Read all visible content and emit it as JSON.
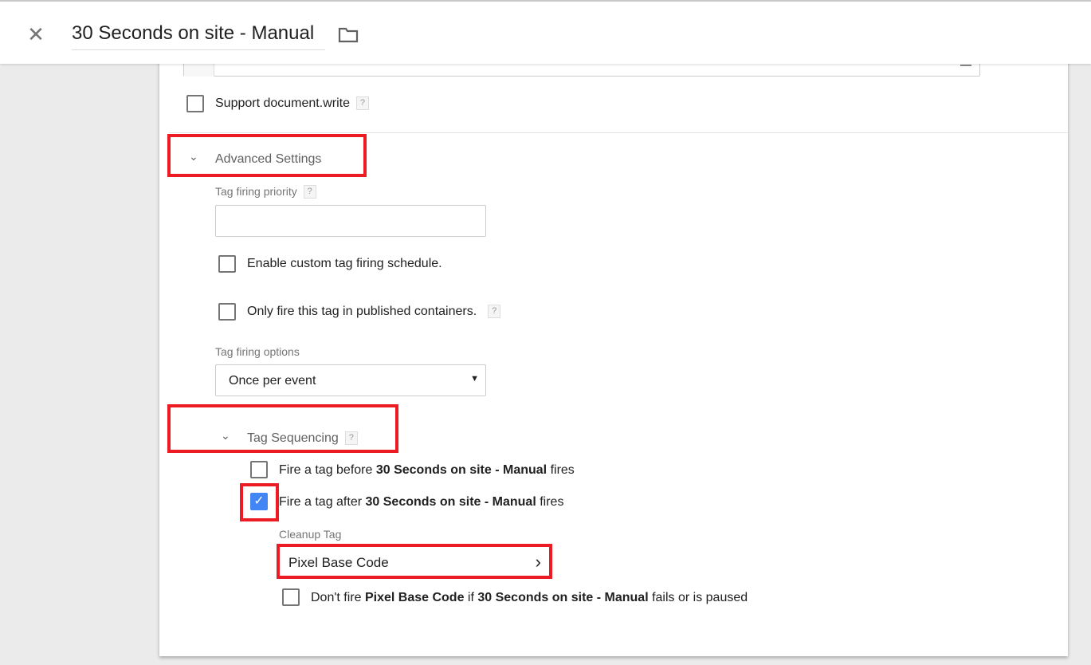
{
  "header": {
    "title": "30 Seconds on site - Manual",
    "close_icon": "close-icon",
    "folder_icon": "folder-icon"
  },
  "support_document_write": {
    "label": "Support document.write",
    "checked": false,
    "help": "?"
  },
  "advanced": {
    "title": "Advanced Settings",
    "priority_label": "Tag firing priority",
    "priority_value": "",
    "help": "?",
    "custom_schedule": {
      "label": "Enable custom tag firing schedule.",
      "checked": false
    },
    "published_only": {
      "label": "Only fire this tag in published containers.",
      "checked": false
    },
    "firing_options_label": "Tag firing options",
    "firing_options_value": "Once per event"
  },
  "sequencing": {
    "title": "Tag Sequencing",
    "help": "?",
    "before": {
      "pre": "Fire a tag before ",
      "tag": "30 Seconds on site - Manual",
      "post": " fires",
      "checked": false
    },
    "after": {
      "pre": "Fire a tag after ",
      "tag": "30 Seconds on site - Manual",
      "post": " fires",
      "checked": true
    },
    "cleanup_label": "Cleanup Tag",
    "cleanup_value": "Pixel Base Code",
    "dont_fire": {
      "p1": "Don't fire ",
      "t1": "Pixel Base Code",
      "p2": " if ",
      "t2": "30 Seconds on site - Manual",
      "p3": " fails or is paused",
      "checked": false
    }
  },
  "colors": {
    "highlight": "#ed1c24",
    "checkbox_checked": "#4285f4"
  }
}
